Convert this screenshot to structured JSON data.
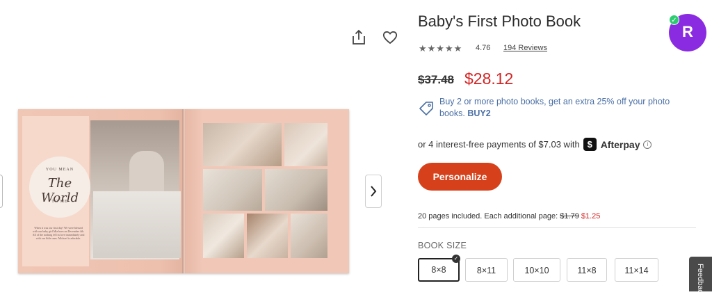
{
  "product": {
    "title": "Baby's First Photo Book",
    "stars": "★★★★★",
    "rating": "4.76",
    "reviews_label": "194 Reviews",
    "old_price": "$37.48",
    "new_price": "$28.12",
    "promo_text": "Buy 2 or more photo books, get an extra 25% off your photo books.",
    "promo_code": "BUY2",
    "afterpay_text": "or 4 interest-free payments of $7.03 with",
    "afterpay_badge": "$",
    "afterpay_name": "Afterpay",
    "info_glyph": "i",
    "personalize_label": "Personalize",
    "pages_text": "20 pages included.  Each additional page:",
    "pages_old_price": "$1.79",
    "pages_new_price": "$1.25",
    "book_size_label": "BOOK SIZE",
    "sizes": [
      "8×8",
      "8×11",
      "10×10",
      "11×8",
      "11×14"
    ],
    "selected_size": "8×8"
  },
  "book_preview": {
    "circle_top": "YOU MEAN",
    "circle_script": "The World",
    "circle_bottom": "TO ME",
    "caption": "When it was our first day! We were blessed with our baby girl Mia born on December 4th. All of the nothing fell in love immediately and with our little ones. Michael is adorable."
  },
  "extension_badge": {
    "letter": "R",
    "check": "✓"
  },
  "feedback_tab": {
    "label": "Feedback"
  },
  "icons": {
    "share": "share-icon",
    "favorite": "heart-icon",
    "next": "chevron-right-icon",
    "promo": "tag-icon"
  },
  "colors": {
    "price_red": "#d42323",
    "button_orange": "#d6411b",
    "promo_blue": "#4a6fa5",
    "badge_purple": "#8a2be2",
    "book_pink": "#efc3b3"
  }
}
